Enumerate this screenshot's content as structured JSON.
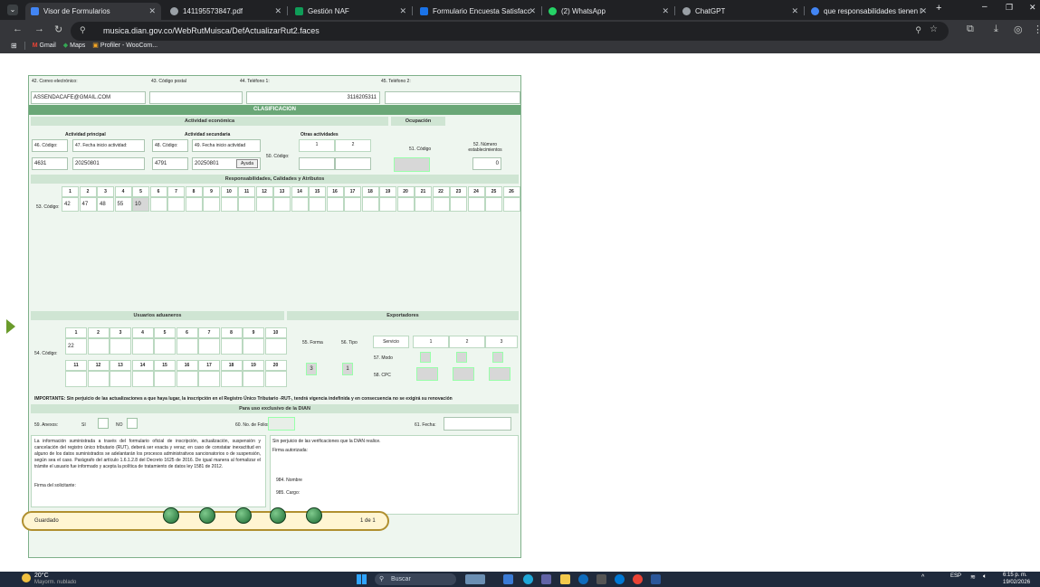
{
  "browser": {
    "tabs": [
      {
        "label": "Visor de Formularios",
        "color": "#4285f4"
      },
      {
        "label": "141195573847.pdf",
        "color": "#9aa0a6"
      },
      {
        "label": "Gestión NAF",
        "color": "#0f9d58"
      },
      {
        "label": "Formulario Encuesta Satisfacció",
        "color": "#1a73e8"
      },
      {
        "label": "(2) WhatsApp",
        "color": "#25d366"
      },
      {
        "label": "ChatGPT",
        "color": "#9aa0a6"
      },
      {
        "label": "que responsabilidades tienen l",
        "color": "#4285f4"
      }
    ],
    "url": "musica.dian.gov.co/WebRutMuisca/DefActualizarRut2.faces",
    "bookmarks": [
      "Gmail",
      "Maps",
      "Profiler - WooCom..."
    ]
  },
  "form": {
    "contact": {
      "email_label": "42. Correo electrónico:",
      "email_value": "ASSENDACAFE@GMAIL.COM",
      "postal_label": "43. Código postal",
      "phone1_label": "44. Teléfono 1:",
      "phone1_value": "3116205311",
      "phone2_label": "45. Teléfono 2:"
    },
    "clasificacion": "CLASIFICACION",
    "actividad_economica": "Actividad económica",
    "ocupacion": "Ocupación",
    "actividad_principal": "Actividad principal",
    "actividad_secundaria": "Actividad secundaria",
    "otras_actividades": "Otras actividades",
    "l46": "46. Código:",
    "l47": "47. Fecha inicio actividad:",
    "l48": "48. Código:",
    "l49": "49. Fecha inicio actividad",
    "l50": "50. Código:",
    "l51": "51. Código",
    "l52": "52. Número establecimientos",
    "v46": "4631",
    "v47": "20250801",
    "v48": "4791",
    "v49": "20250801",
    "v52": "0",
    "ayuda": "Ayuda",
    "otras_1": "1",
    "otras_2": "2",
    "resp_title": "Responsabilidades, Calidades y Atributos",
    "resp_numbers": [
      "1",
      "2",
      "3",
      "4",
      "5",
      "6",
      "7",
      "8",
      "9",
      "10",
      "11",
      "12",
      "13",
      "14",
      "15",
      "16",
      "17",
      "18",
      "19",
      "20",
      "21",
      "22",
      "23",
      "24",
      "25",
      "26"
    ],
    "resp_values": [
      "42",
      "47",
      "48",
      "55",
      "10",
      "",
      "",
      "",
      "",
      "",
      "",
      "",
      "",
      "",
      "",
      "",
      "",
      "",
      "",
      "",
      "",
      "",
      "",
      "",
      "",
      ""
    ],
    "l53": "53. Código:",
    "usuarios_aduaneros": "Usuarios aduaneros",
    "exportadores": "Exportadores",
    "l54": "54. Código:",
    "ua_row1": [
      "1",
      "2",
      "3",
      "4",
      "5",
      "6",
      "7",
      "8",
      "9",
      "10"
    ],
    "ua_row2": [
      "11",
      "12",
      "13",
      "14",
      "15",
      "16",
      "17",
      "18",
      "19",
      "20"
    ],
    "ua_val1": [
      "22",
      "",
      "",
      "",
      "",
      "",
      "",
      "",
      "",
      ""
    ],
    "l55": "55. Forma",
    "l56": "56. Tipo",
    "v55": "3",
    "v56": "1",
    "servicio": "Servicio",
    "s1": "1",
    "s2": "2",
    "s3": "3",
    "l57": "57. Modo",
    "l58": "58. CPC",
    "importante": "IMPORTANTE: Sin perjuicio de las actualizaciones a que haya lugar, la inscripción en el Registro Único Tributario -RUT-, tendrá vigencia indefinida y en consecuencia no se exigirá su renovación",
    "uso_dian": "Para uso exclusivo de la DIAN",
    "l59": "59. Anexos:",
    "si": "SI",
    "no": "NO",
    "l60": "60. No. de Folios:",
    "l61": "61. Fecha:",
    "legal_text": "La información suministrada a través del formulario oficial de inscripción, actualización, suspensión y cancelación del registro único tributario (RUT), deberá ser exacta y veraz; en caso de constatar inexactitud en alguno de los datos suministrados se adelantarán los procesos administrativos sancionatorios o de suspensión, según sea el caso. Parágrafo del artículo 1.6.1.2.8 del Decreto 1625 de 2016. De igual manera al formalizar el trámite el usuario fue informado y acepta la política de tratamiento de datos ley 1581 de 2012.",
    "firma_solicitante": "Firma del solicitante:",
    "verificaciones": "Sin perjuicio de las verificaciones que la DIAN realice.",
    "firma_autorizada": "Firma autorizada:",
    "l984": "984. Nombre",
    "l985": "985. Cargo:",
    "status": "Guardado",
    "page": "1 de 1"
  },
  "taskbar": {
    "weather_temp": "20°C",
    "weather_desc": "Mayorm. nublado",
    "search": "Buscar",
    "lang": "ESP",
    "time": "6:15 p. m.",
    "date": "19/02/2026"
  }
}
